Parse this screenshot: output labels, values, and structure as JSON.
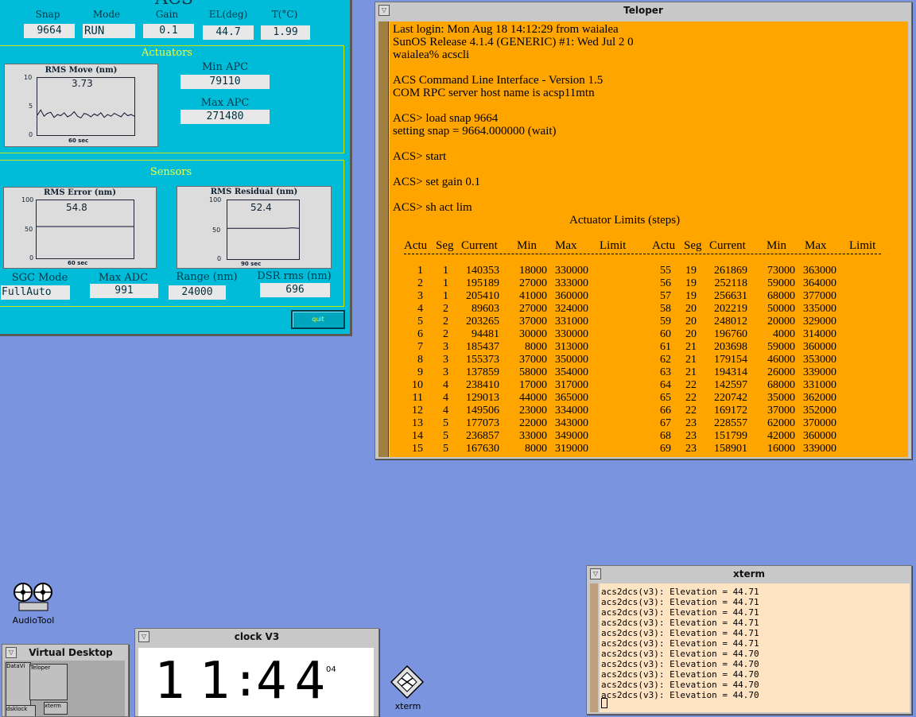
{
  "acs": {
    "header_title": "ACS",
    "labels": {
      "snap": "Snap",
      "mode": "Mode",
      "gain": "Gain",
      "el": "EL(deg)",
      "temp": "T(°C)"
    },
    "values": {
      "snap": "9664",
      "mode": "RUN",
      "gain": "0.1",
      "el": "44.7",
      "temp": "1.99"
    },
    "actuators": {
      "title": "Actuators",
      "chart_title": "RMS Move (nm)",
      "chart_value": "3.73",
      "chart_footer": "60 sec",
      "ticks": [
        "10",
        "5",
        "0"
      ],
      "min_apc_label": "Min APC",
      "min_apc": "79110",
      "max_apc_label": "Max APC",
      "max_apc": "271480"
    },
    "sensors": {
      "title": "Sensors",
      "error_title": "RMS Error (nm)",
      "error_value": "54.8",
      "error_footer": "60 sec",
      "error_ticks": [
        "100",
        "50",
        "0"
      ],
      "residual_title": "RMS Residual (nm)",
      "residual_value": "52.4",
      "residual_footer": "90 sec",
      "residual_ticks": [
        "100",
        "50",
        "0"
      ],
      "sgc_label": "SGC Mode",
      "sgc": "FullAuto",
      "maxadc_label": "Max ADC",
      "maxadc": "991",
      "range_label": "Range (nm)",
      "range": "24000",
      "dsr_label": "DSR rms (nm)",
      "dsr": "696"
    },
    "quit_label": "quit"
  },
  "teloper": {
    "title": "Teloper",
    "lines": [
      "Last login: Mon Aug 18 14:12:29 from waialea",
      "SunOS Release 4.1.4 (GENERIC) #1: Wed Jul 2 0",
      "waialea% acscli",
      "",
      "ACS Command Line Interface - Version 1.5",
      "COM RPC server host name is acsp11mtn",
      "",
      "ACS> load snap 9664",
      "setting snap = 9664.000000 (wait)",
      "",
      "ACS> start",
      "",
      "ACS> set gain 0.1",
      "",
      "ACS> sh act lim"
    ],
    "table_title": "Actuator Limits (steps)",
    "headers": [
      "Actu",
      "Seg",
      "Current",
      "Min",
      "Max",
      "Limit",
      "Actu",
      "Seg",
      "Current",
      "Min",
      "Max",
      "Limit"
    ],
    "rows": [
      [
        "1",
        "1",
        "140353",
        "18000",
        "330000",
        "55",
        "19",
        "261869",
        "73000",
        "363000"
      ],
      [
        "2",
        "1",
        "195189",
        "27000",
        "333000",
        "56",
        "19",
        "252118",
        "59000",
        "364000"
      ],
      [
        "3",
        "1",
        "205410",
        "41000",
        "360000",
        "57",
        "19",
        "256631",
        "68000",
        "377000"
      ],
      [
        "4",
        "2",
        "89603",
        "27000",
        "324000",
        "58",
        "20",
        "202219",
        "50000",
        "335000"
      ],
      [
        "5",
        "2",
        "203265",
        "37000",
        "331000",
        "59",
        "20",
        "248012",
        "20000",
        "329000"
      ],
      [
        "6",
        "2",
        "94481",
        "30000",
        "330000",
        "60",
        "20",
        "196760",
        "4000",
        "314000"
      ],
      [
        "7",
        "3",
        "185437",
        "8000",
        "313000",
        "61",
        "21",
        "203698",
        "59000",
        "360000"
      ],
      [
        "8",
        "3",
        "155373",
        "37000",
        "350000",
        "62",
        "21",
        "179154",
        "46000",
        "353000"
      ],
      [
        "9",
        "3",
        "137859",
        "58000",
        "354000",
        "63",
        "21",
        "194314",
        "26000",
        "339000"
      ],
      [
        "10",
        "4",
        "238410",
        "17000",
        "317000",
        "64",
        "22",
        "142597",
        "68000",
        "331000"
      ],
      [
        "11",
        "4",
        "129013",
        "44000",
        "365000",
        "65",
        "22",
        "220742",
        "35000",
        "362000"
      ],
      [
        "12",
        "4",
        "149506",
        "23000",
        "334000",
        "66",
        "22",
        "169172",
        "37000",
        "352000"
      ],
      [
        "13",
        "5",
        "177073",
        "22000",
        "343000",
        "67",
        "23",
        "228557",
        "62000",
        "370000"
      ],
      [
        "14",
        "5",
        "236857",
        "33000",
        "349000",
        "68",
        "23",
        "151799",
        "42000",
        "360000"
      ],
      [
        "15",
        "5",
        "167630",
        "8000",
        "319000",
        "69",
        "23",
        "158901",
        "16000",
        "339000"
      ]
    ]
  },
  "xterm": {
    "title": "xterm",
    "lines": [
      "acs2dcs(v3): Elevation = 44.71",
      "acs2dcs(v3): Elevation = 44.71",
      "acs2dcs(v3): Elevation = 44.71",
      "acs2dcs(v3): Elevation = 44.71",
      "acs2dcs(v3): Elevation = 44.71",
      "acs2dcs(v3): Elevation = 44.71",
      "acs2dcs(v3): Elevation = 44.70",
      "acs2dcs(v3): Elevation = 44.70",
      "acs2dcs(v3): Elevation = 44.70",
      "acs2dcs(v3): Elevation = 44.70",
      "acs2dcs(v3): Elevation = 44.70"
    ]
  },
  "clock": {
    "title": "clock V3",
    "hours": "11",
    "minutes": "44",
    "seconds": "04"
  },
  "vdesk": {
    "title": "Virtual Desktop",
    "win_teloper": "Teloper",
    "win_data": "DataVi",
    "win_xterm": "xterm",
    "win_dsk": "dsklock"
  },
  "icons": {
    "audiotool": "AudioTool",
    "xterm": "xterm"
  },
  "chart_data": [
    {
      "type": "line",
      "title": "RMS Move (nm)",
      "ylim": [
        0,
        10
      ],
      "xlabel": "60 sec",
      "values": [
        3.5,
        4.4,
        3.3,
        3.8,
        4.0,
        3.1,
        3.6,
        3.4,
        3.9,
        3.2,
        3.5,
        4.1,
        3.3,
        3.0,
        3.8,
        3.6,
        3.2,
        3.7,
        3.4,
        3.9,
        3.1,
        3.6,
        3.3,
        3.8,
        3.5,
        3.2,
        3.9,
        3.4,
        3.6,
        3.3
      ]
    },
    {
      "type": "line",
      "title": "RMS Error (nm)",
      "ylim": [
        0,
        100
      ],
      "xlabel": "60 sec",
      "values": [
        54.8,
        54.8,
        54.8,
        54.8,
        54.8,
        54.8,
        54.8,
        54.8,
        54.8,
        54.8
      ]
    },
    {
      "type": "line",
      "title": "RMS Residual (nm)",
      "ylim": [
        0,
        100
      ],
      "xlabel": "90 sec",
      "values": [
        52.4,
        52.4,
        52.4,
        52.4,
        52.4,
        52.4,
        52.4,
        52.4,
        52.4,
        52.4,
        53.2,
        52.4
      ]
    }
  ]
}
